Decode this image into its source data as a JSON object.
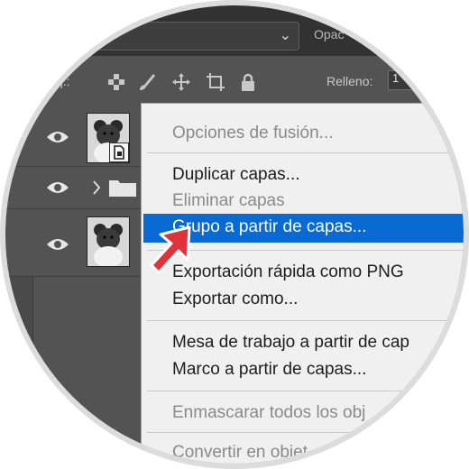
{
  "top_bar": {
    "opacity_label": "Opac"
  },
  "lock_bar": {
    "lock_label": "q.:",
    "fill_label": "Relleno:",
    "fill_value": "1"
  },
  "context_menu": {
    "items": [
      {
        "label": "Opciones de fusión...",
        "enabled": false
      },
      {
        "label": "Duplicar capas...",
        "enabled": true
      },
      {
        "label": "Eliminar capas",
        "enabled": false
      },
      {
        "label": "Grupo a partir de capas...",
        "enabled": true,
        "highlighted": true
      },
      {
        "label": "Exportación rápida como PNG",
        "enabled": true
      },
      {
        "label": "Exportar como...",
        "enabled": true
      },
      {
        "label": "Mesa de trabajo a partir de cap",
        "enabled": true
      },
      {
        "label": "Marco a partir de capas...",
        "enabled": true
      },
      {
        "label": "Enmascarar todos los obj",
        "enabled": false
      },
      {
        "label": "Convertir en objet",
        "enabled": false
      }
    ]
  },
  "colors": {
    "highlight": "#0a6ad4",
    "arrow": "#e0323a",
    "panel": "#535353",
    "menu_bg": "#f0f0f0"
  },
  "icons": [
    "chevron-down-icon",
    "checker-lock-icon",
    "brush-lock-icon",
    "move-lock-icon",
    "artboard-lock-icon",
    "padlock-icon",
    "eye-icon",
    "folder-icon",
    "chevron-right-icon",
    "red-arrow-icon"
  ]
}
